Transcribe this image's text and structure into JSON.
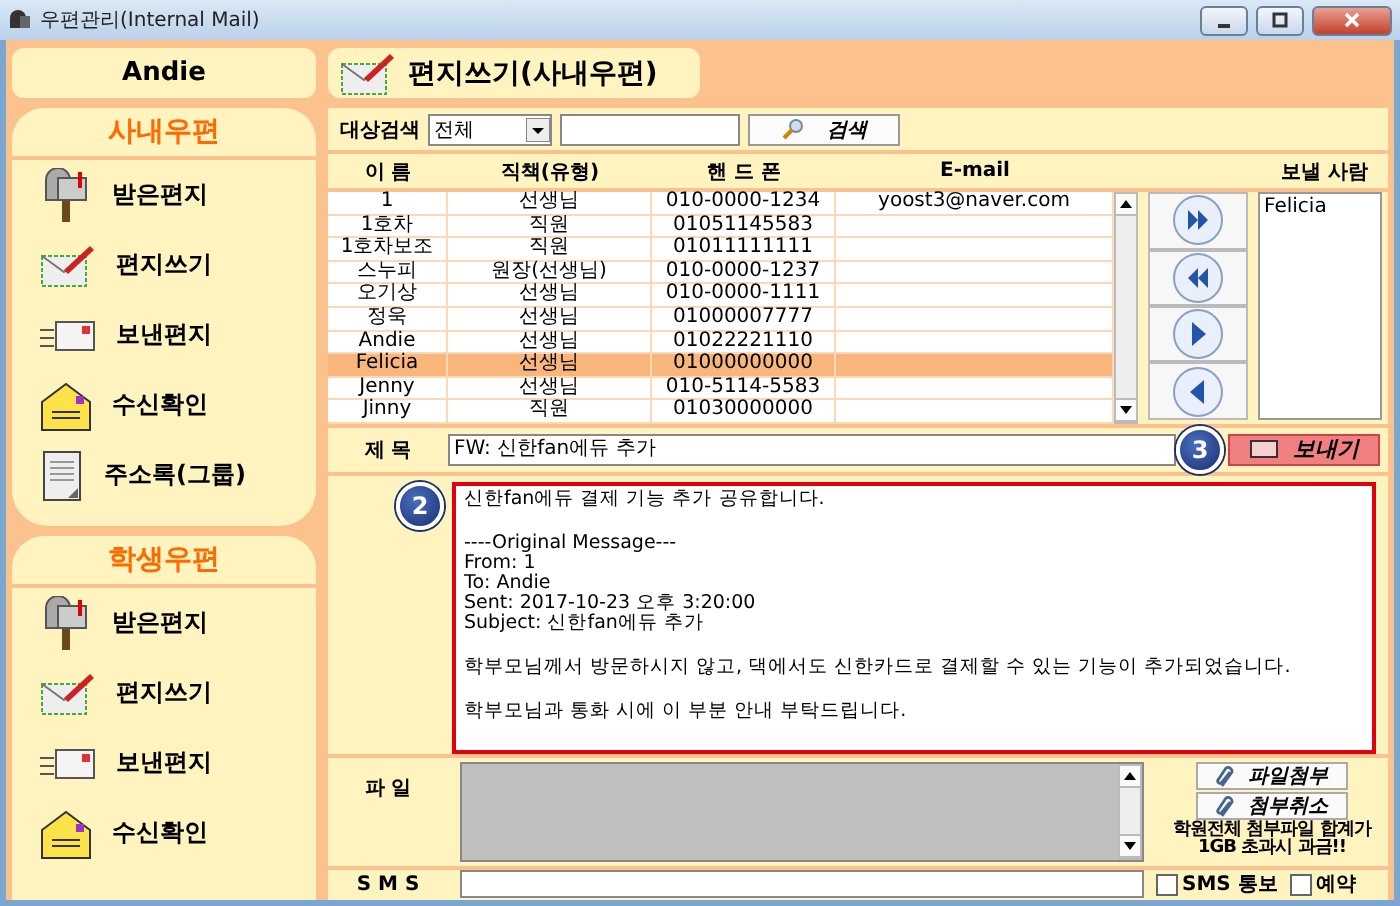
{
  "window": {
    "title": "우편관리(Internal Mail)"
  },
  "user_name": "Andie",
  "sidebar": {
    "sections": [
      {
        "title": "사내우편",
        "items": [
          {
            "label": "받은편지",
            "kind": "inbox"
          },
          {
            "label": "편지쓰기",
            "kind": "write"
          },
          {
            "label": "보낸편지",
            "kind": "sent"
          },
          {
            "label": "수신확인",
            "kind": "receipt"
          },
          {
            "label": "주소록(그룹)",
            "kind": "contacts"
          }
        ]
      },
      {
        "title": "학생우편",
        "items": [
          {
            "label": "받은편지",
            "kind": "inbox"
          },
          {
            "label": "편지쓰기",
            "kind": "write"
          },
          {
            "label": "보낸편지",
            "kind": "sent"
          },
          {
            "label": "수신확인",
            "kind": "receipt"
          }
        ]
      }
    ]
  },
  "header": {
    "title": "편지쓰기(사내우편)"
  },
  "search": {
    "label": "대상검색",
    "select_value": "전체",
    "button": "검색"
  },
  "table": {
    "columns": [
      "이 름",
      "직책(유형)",
      "핸 드 폰",
      "E-mail"
    ],
    "rows": [
      {
        "cells": [
          "1",
          "선생님",
          "010-0000-1234",
          "yoost3@naver.com"
        ],
        "selected": false
      },
      {
        "cells": [
          "1호차",
          "직원",
          "01051145583",
          ""
        ],
        "selected": false
      },
      {
        "cells": [
          "1호차보조",
          "직원",
          "01011111111",
          ""
        ],
        "selected": false
      },
      {
        "cells": [
          "스누피",
          "원장(선생님)",
          "010-0000-1237",
          ""
        ],
        "selected": false
      },
      {
        "cells": [
          "오기상",
          "선생님",
          "010-0000-1111",
          ""
        ],
        "selected": false
      },
      {
        "cells": [
          "정욱",
          "선생님",
          "01000007777",
          ""
        ],
        "selected": false
      },
      {
        "cells": [
          "Andie",
          "선생님",
          "01022221110",
          ""
        ],
        "selected": false
      },
      {
        "cells": [
          "Felicia",
          "선생님",
          "01000000000",
          ""
        ],
        "selected": true
      },
      {
        "cells": [
          "Jenny",
          "선생님",
          "010-5114-5583",
          ""
        ],
        "selected": false
      },
      {
        "cells": [
          "Jinny",
          "직원",
          "01030000000",
          ""
        ],
        "selected": false
      }
    ]
  },
  "recipients": {
    "title": "보낼 사람",
    "items": [
      "Felicia"
    ]
  },
  "subject": {
    "label": "제 목",
    "value": "FW: 신한fan에듀 추가"
  },
  "send_button": {
    "label": "보내기",
    "badge": "3"
  },
  "message": {
    "badge": "2",
    "paragraphs": [
      [
        "신한fan에듀 결제 기능 추가 공유합니다."
      ],
      [
        "----Original Message---",
        "From: 1",
        "To: Andie",
        "Sent: 2017-10-23 오후 3:20:00",
        "Subject: 신한fan에듀 추가"
      ],
      [
        "학부모님께서 방문하시지 않고, 댁에서도 신한카드로 결제할 수 있는 기능이 추가되었습니다."
      ],
      [
        "학부모님과 통화 시에 이 부분 안내 부탁드립니다."
      ]
    ]
  },
  "file": {
    "label": "파 일",
    "buttons": [
      "파일첨부",
      "첨부취소"
    ],
    "notice": "학원전체 첨부파일 합계가 1GB 초과시 과금!!"
  },
  "sms": {
    "label": "S M S",
    "checkboxes": [
      {
        "label": "SMS 통보",
        "checked": false
      },
      {
        "label": "예약",
        "checked": false
      }
    ]
  }
}
